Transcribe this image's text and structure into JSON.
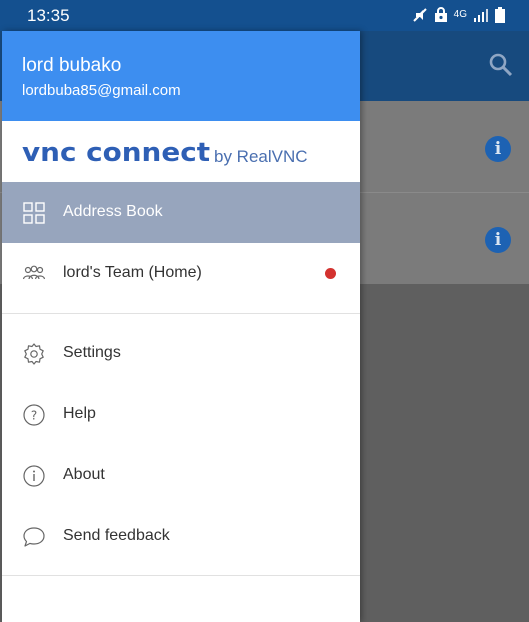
{
  "status_bar": {
    "time": "13:35",
    "icons": [
      "mute-icon",
      "lock-icon",
      "4g-icon",
      "signal-icon",
      "battery-icon"
    ],
    "network_label": "4G"
  },
  "drawer": {
    "user": {
      "name": "lord bubako",
      "email": "lordbuba85@gmail.com"
    },
    "logo": {
      "main": "VNC CONNECT",
      "by": "by RealVNC"
    },
    "items": [
      {
        "label": "Address Book",
        "icon": "grid-icon",
        "selected": true
      },
      {
        "label": "lord's Team (Home)",
        "icon": "team-icon",
        "badge": "notification-dot"
      },
      {
        "label": "Settings",
        "icon": "gear-icon"
      },
      {
        "label": "Help",
        "icon": "help-icon"
      },
      {
        "label": "About",
        "icon": "info-icon"
      },
      {
        "label": "Send feedback",
        "icon": "chat-icon"
      }
    ]
  },
  "colors": {
    "header": "#3d8ef0",
    "status_bar": "#14508f",
    "selected_row": "#97a5bd",
    "notify": "#d3322f",
    "logo": "#2e5fb5"
  }
}
